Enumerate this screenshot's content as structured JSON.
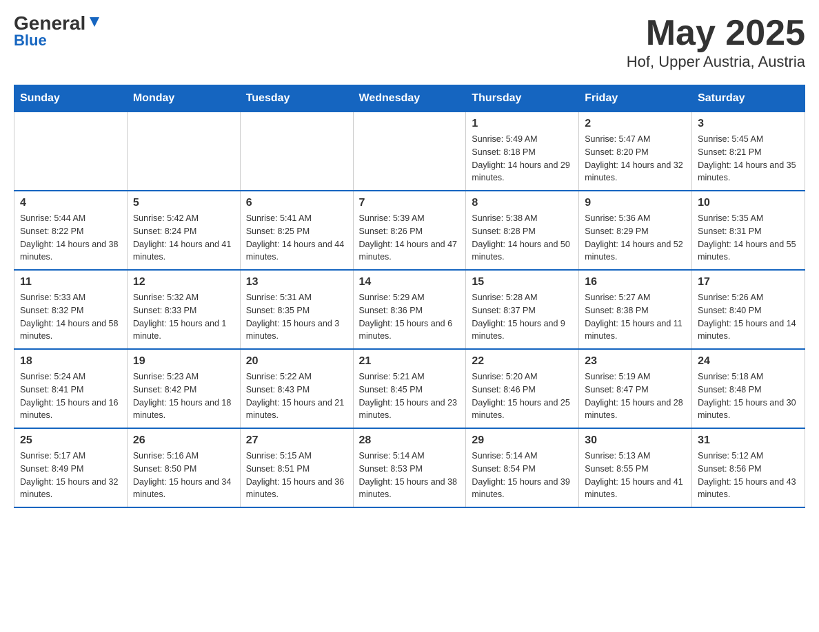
{
  "logo": {
    "general": "General",
    "arrow": "▶",
    "blue": "Blue"
  },
  "title": "May 2025",
  "subtitle": "Hof, Upper Austria, Austria",
  "days_of_week": [
    "Sunday",
    "Monday",
    "Tuesday",
    "Wednesday",
    "Thursday",
    "Friday",
    "Saturday"
  ],
  "weeks": [
    [
      {
        "day": "",
        "info": ""
      },
      {
        "day": "",
        "info": ""
      },
      {
        "day": "",
        "info": ""
      },
      {
        "day": "",
        "info": ""
      },
      {
        "day": "1",
        "info": "Sunrise: 5:49 AM\nSunset: 8:18 PM\nDaylight: 14 hours and 29 minutes."
      },
      {
        "day": "2",
        "info": "Sunrise: 5:47 AM\nSunset: 8:20 PM\nDaylight: 14 hours and 32 minutes."
      },
      {
        "day": "3",
        "info": "Sunrise: 5:45 AM\nSunset: 8:21 PM\nDaylight: 14 hours and 35 minutes."
      }
    ],
    [
      {
        "day": "4",
        "info": "Sunrise: 5:44 AM\nSunset: 8:22 PM\nDaylight: 14 hours and 38 minutes."
      },
      {
        "day": "5",
        "info": "Sunrise: 5:42 AM\nSunset: 8:24 PM\nDaylight: 14 hours and 41 minutes."
      },
      {
        "day": "6",
        "info": "Sunrise: 5:41 AM\nSunset: 8:25 PM\nDaylight: 14 hours and 44 minutes."
      },
      {
        "day": "7",
        "info": "Sunrise: 5:39 AM\nSunset: 8:26 PM\nDaylight: 14 hours and 47 minutes."
      },
      {
        "day": "8",
        "info": "Sunrise: 5:38 AM\nSunset: 8:28 PM\nDaylight: 14 hours and 50 minutes."
      },
      {
        "day": "9",
        "info": "Sunrise: 5:36 AM\nSunset: 8:29 PM\nDaylight: 14 hours and 52 minutes."
      },
      {
        "day": "10",
        "info": "Sunrise: 5:35 AM\nSunset: 8:31 PM\nDaylight: 14 hours and 55 minutes."
      }
    ],
    [
      {
        "day": "11",
        "info": "Sunrise: 5:33 AM\nSunset: 8:32 PM\nDaylight: 14 hours and 58 minutes."
      },
      {
        "day": "12",
        "info": "Sunrise: 5:32 AM\nSunset: 8:33 PM\nDaylight: 15 hours and 1 minute."
      },
      {
        "day": "13",
        "info": "Sunrise: 5:31 AM\nSunset: 8:35 PM\nDaylight: 15 hours and 3 minutes."
      },
      {
        "day": "14",
        "info": "Sunrise: 5:29 AM\nSunset: 8:36 PM\nDaylight: 15 hours and 6 minutes."
      },
      {
        "day": "15",
        "info": "Sunrise: 5:28 AM\nSunset: 8:37 PM\nDaylight: 15 hours and 9 minutes."
      },
      {
        "day": "16",
        "info": "Sunrise: 5:27 AM\nSunset: 8:38 PM\nDaylight: 15 hours and 11 minutes."
      },
      {
        "day": "17",
        "info": "Sunrise: 5:26 AM\nSunset: 8:40 PM\nDaylight: 15 hours and 14 minutes."
      }
    ],
    [
      {
        "day": "18",
        "info": "Sunrise: 5:24 AM\nSunset: 8:41 PM\nDaylight: 15 hours and 16 minutes."
      },
      {
        "day": "19",
        "info": "Sunrise: 5:23 AM\nSunset: 8:42 PM\nDaylight: 15 hours and 18 minutes."
      },
      {
        "day": "20",
        "info": "Sunrise: 5:22 AM\nSunset: 8:43 PM\nDaylight: 15 hours and 21 minutes."
      },
      {
        "day": "21",
        "info": "Sunrise: 5:21 AM\nSunset: 8:45 PM\nDaylight: 15 hours and 23 minutes."
      },
      {
        "day": "22",
        "info": "Sunrise: 5:20 AM\nSunset: 8:46 PM\nDaylight: 15 hours and 25 minutes."
      },
      {
        "day": "23",
        "info": "Sunrise: 5:19 AM\nSunset: 8:47 PM\nDaylight: 15 hours and 28 minutes."
      },
      {
        "day": "24",
        "info": "Sunrise: 5:18 AM\nSunset: 8:48 PM\nDaylight: 15 hours and 30 minutes."
      }
    ],
    [
      {
        "day": "25",
        "info": "Sunrise: 5:17 AM\nSunset: 8:49 PM\nDaylight: 15 hours and 32 minutes."
      },
      {
        "day": "26",
        "info": "Sunrise: 5:16 AM\nSunset: 8:50 PM\nDaylight: 15 hours and 34 minutes."
      },
      {
        "day": "27",
        "info": "Sunrise: 5:15 AM\nSunset: 8:51 PM\nDaylight: 15 hours and 36 minutes."
      },
      {
        "day": "28",
        "info": "Sunrise: 5:14 AM\nSunset: 8:53 PM\nDaylight: 15 hours and 38 minutes."
      },
      {
        "day": "29",
        "info": "Sunrise: 5:14 AM\nSunset: 8:54 PM\nDaylight: 15 hours and 39 minutes."
      },
      {
        "day": "30",
        "info": "Sunrise: 5:13 AM\nSunset: 8:55 PM\nDaylight: 15 hours and 41 minutes."
      },
      {
        "day": "31",
        "info": "Sunrise: 5:12 AM\nSunset: 8:56 PM\nDaylight: 15 hours and 43 minutes."
      }
    ]
  ]
}
